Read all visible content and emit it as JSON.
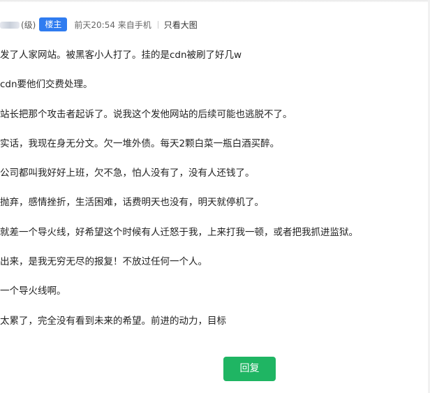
{
  "post": {
    "author": "(级)",
    "role_badge": "楼主",
    "post_time": "前天20:54 来自手机",
    "view_original": "只看大图",
    "lines": [
      "发了人家网站。被黑客小人打了。挂的是cdn被刷了好几w",
      "cdn要他们交费处理。",
      "站长把那个攻击者起诉了。说我这个发他网站的后续可能也逃脱不了。",
      "实话，我现在身无分文。欠一堆外债。每天2颗白菜一瓶白酒买醉。",
      "公司都叫我好好上班，欠不急，怕人没有了，没有人还钱了。",
      "抛弃，感情挫折，生活困难，话费明天也没有，明天就停机了。",
      "就差一个导火线，好希望这个时候有人迁怒于我，上来打我一顿，或者把我抓进监狱。",
      "出来，是我无穷无尽的报复！不放过任何一个人。",
      "一个导火线啊。",
      "太累了，完全没有看到未来的希望。前进的动力，目标"
    ]
  },
  "actions": {
    "reply_label": "回复"
  },
  "colors": {
    "badge": "#2f7cf0",
    "reply_button": "#1fb563"
  }
}
